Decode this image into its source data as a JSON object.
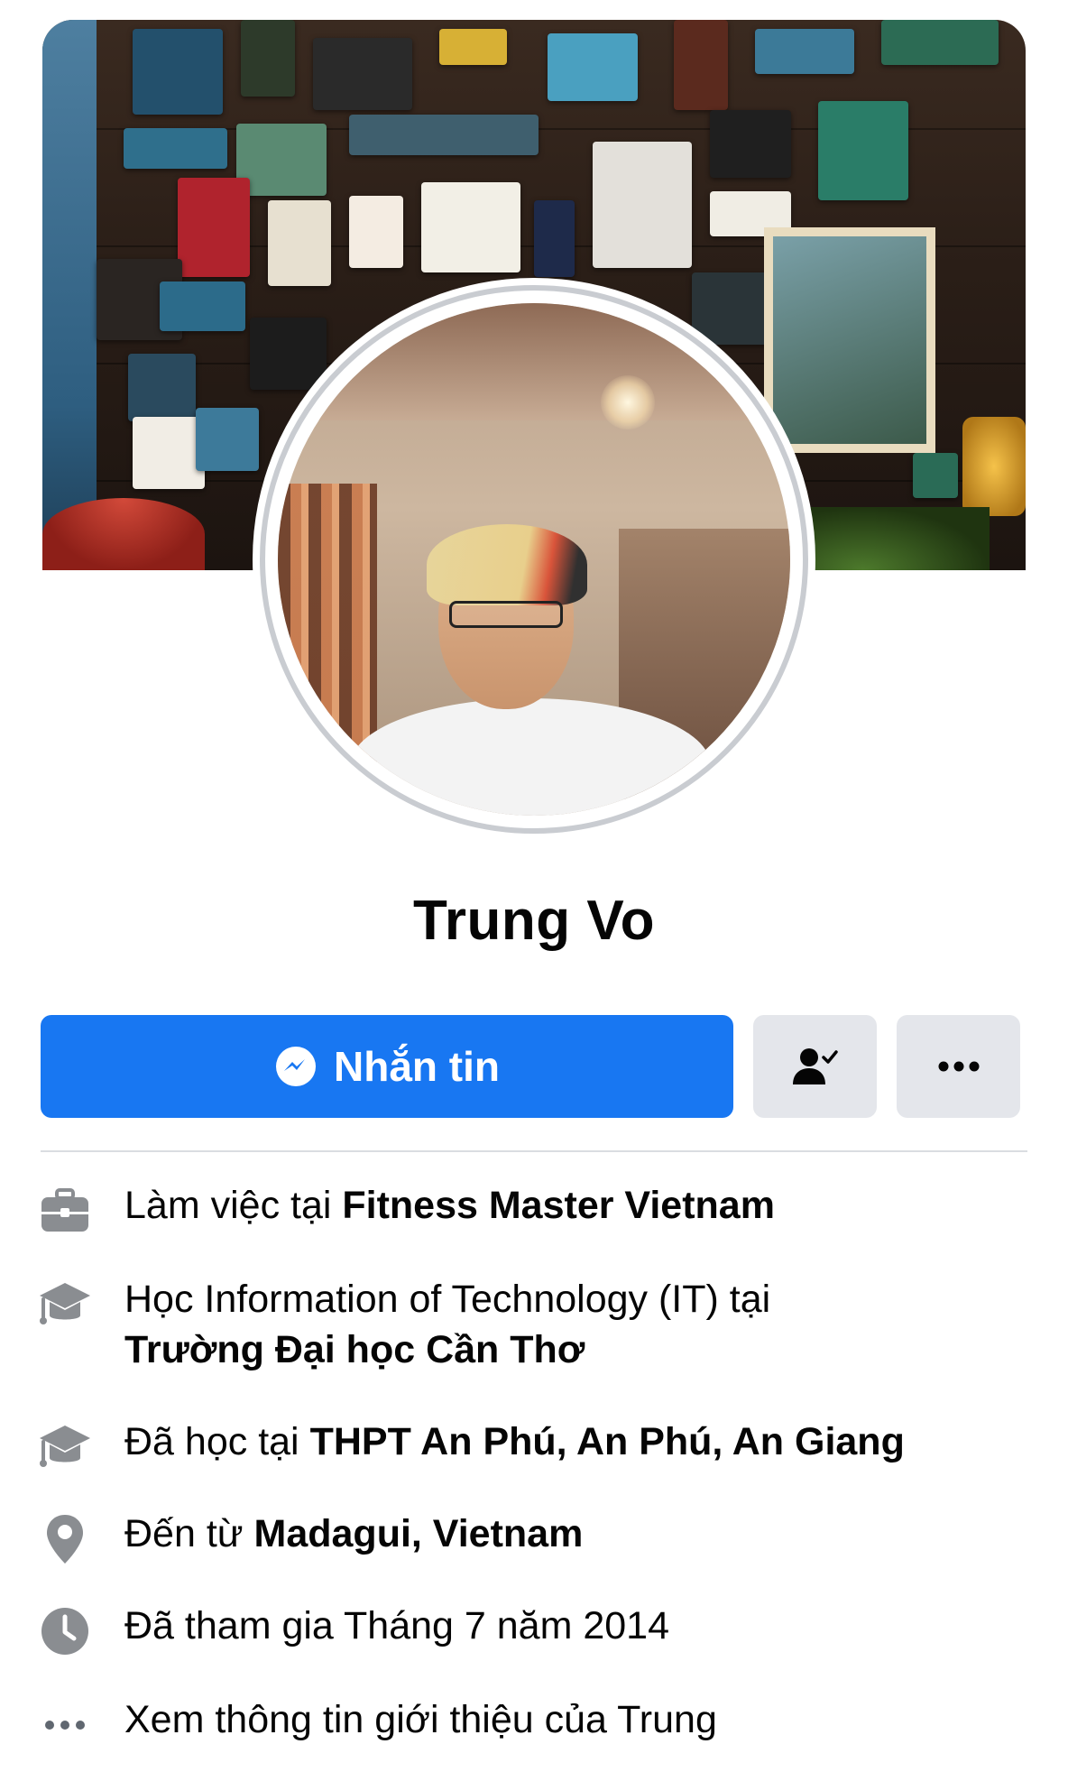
{
  "profile": {
    "name": "Trung Vo"
  },
  "actions": {
    "message_label": "Nhắn tin",
    "friends_icon": "friend-check-icon",
    "more_icon": "more-dots-icon"
  },
  "intro": {
    "work_prefix": "Làm việc tại ",
    "work_place": "Fitness Master Vietnam",
    "study_prefix": "Học Information of Technology (IT) tại ",
    "study_place": "Trường Đại học Cần Thơ",
    "school_prefix": "Đã học tại ",
    "school_place": "THPT An Phú, An Phú, An Giang",
    "from_prefix": "Đến từ ",
    "from_place": "Madagui, Vietnam",
    "joined": "Đã tham gia Tháng 7 năm 2014",
    "see_more": "Xem thông tin giới thiệu của Trung"
  },
  "colors": {
    "primary": "#1877f2",
    "secondary_button": "#e4e6eb",
    "icon_gray": "#8a8d91",
    "text": "#050505"
  }
}
